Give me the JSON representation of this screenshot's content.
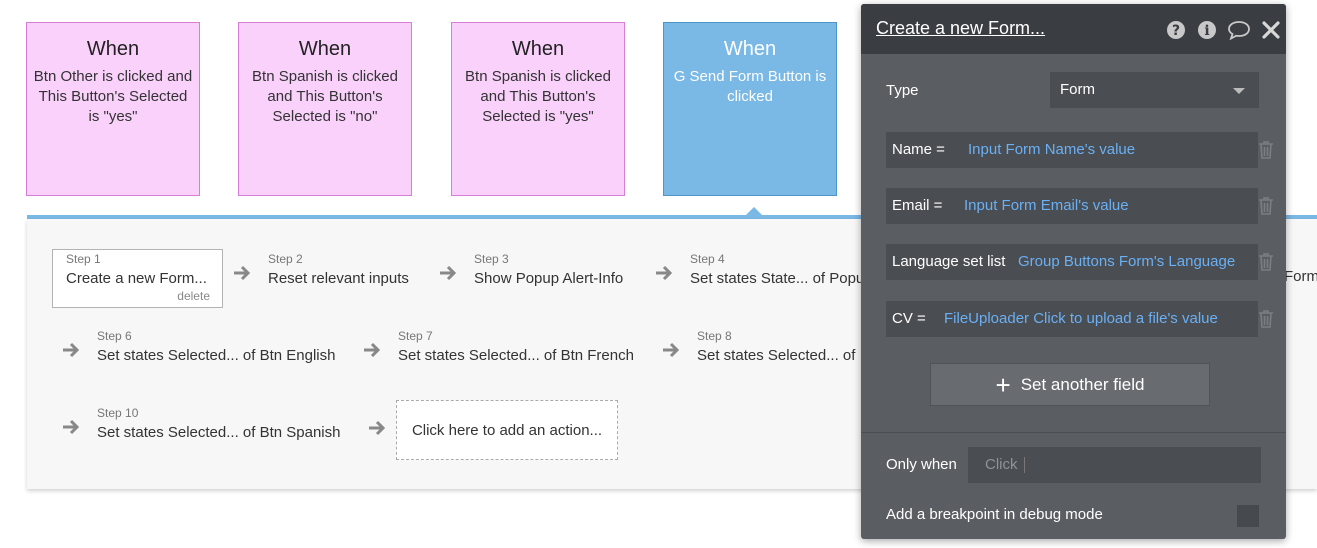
{
  "events": [
    {
      "when": "When",
      "description": "Btn Other is clicked and This Button's Selected is \"yes\"",
      "color": "#f9d1fb"
    },
    {
      "when": "When",
      "description": "Btn Spanish is clicked and This Button's Selected is \"no\"",
      "color": "#f9d1fb"
    },
    {
      "when": "When",
      "description": "Btn Spanish is clicked and This Button's Selected is \"yes\"",
      "color": "#f9d1fb"
    },
    {
      "when": "When",
      "description": "G Send Form Button is clicked",
      "color": "#7ab8e5"
    }
  ],
  "workflow": {
    "steps": [
      {
        "label": "Step 1",
        "title": "Create a new Form...",
        "delete": "delete"
      },
      {
        "label": "Step 2",
        "title": "Reset relevant inputs"
      },
      {
        "label": "Step 3",
        "title": "Show Popup Alert-Info"
      },
      {
        "label": "Step 4",
        "title": "Set states State... of Popu"
      },
      {
        "label": "Step 6",
        "title": "Set states Selected... of Btn English"
      },
      {
        "label": "Step 7",
        "title": "Set states Selected... of Btn French"
      },
      {
        "label": "Step 8",
        "title": "Set states Selected... of"
      },
      {
        "label": "Step 10",
        "title": "Set states Selected... of Btn Spanish"
      }
    ],
    "add_action": "Click here to add an action...",
    "edge_text": "Form"
  },
  "editor": {
    "title": "Create a new Form...",
    "icons": [
      "help-icon",
      "info-icon",
      "comment-icon",
      "close-icon"
    ],
    "type_label": "Type",
    "type_value": "Form",
    "fields": [
      {
        "name": "Name =",
        "value": "Input Form Name's value"
      },
      {
        "name": "Email =",
        "value": "Input Form Email's value"
      },
      {
        "name": "Language set list",
        "value": "Group Buttons Form's Language"
      },
      {
        "name": "CV =",
        "value": "FileUploader Click to upload a file's value"
      }
    ],
    "set_another": "Set another field",
    "only_when_label": "Only when",
    "only_when_placeholder": "Click",
    "breakpoint_label": "Add a breakpoint in debug mode",
    "accent_color": "#6ab0f5"
  }
}
